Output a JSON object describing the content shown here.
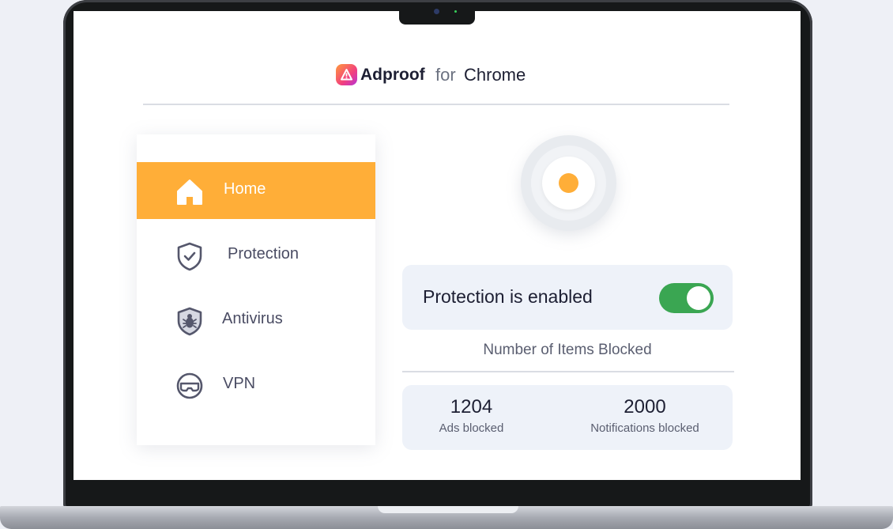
{
  "header": {
    "brand": "Adproof",
    "for_word": "for",
    "platform": "Chrome",
    "logo_icon": "warning-triangle-icon"
  },
  "sidebar": {
    "items": [
      {
        "label": "Home",
        "icon": "home-icon",
        "active": true
      },
      {
        "label": "Protection",
        "icon": "shield-check-icon",
        "active": false
      },
      {
        "label": "Antivirus",
        "icon": "shield-bug-icon",
        "active": false
      },
      {
        "label": "VPN",
        "icon": "vpn-mask-icon",
        "active": false
      }
    ]
  },
  "power": {
    "state": "on"
  },
  "status": {
    "text": "Protection is enabled",
    "toggle_on": true
  },
  "blocked": {
    "title": "Number of Items Blocked",
    "stats": [
      {
        "value": "1204",
        "label": "Ads blocked"
      },
      {
        "value": "2000",
        "label": "Notifications blocked"
      }
    ]
  },
  "colors": {
    "accent": "#ffae38",
    "toggle": "#3aa652",
    "card": "#eef2f9",
    "text_dark": "#1d1f33"
  }
}
